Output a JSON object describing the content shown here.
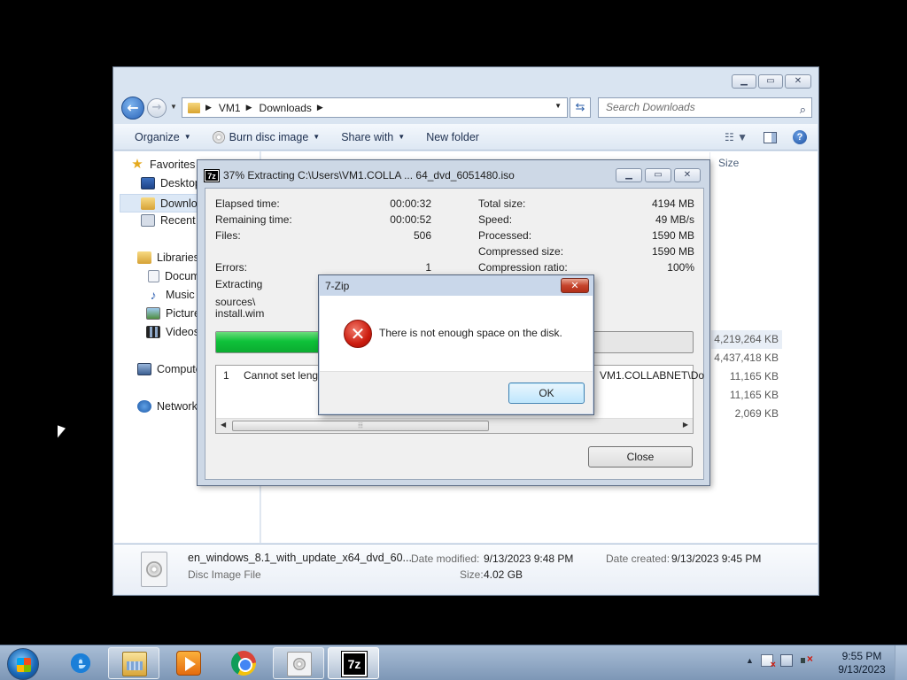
{
  "explorer": {
    "address": {
      "crumbs": [
        "VM1",
        "Downloads"
      ]
    },
    "search": {
      "placeholder": "Search Downloads"
    },
    "toolbar": {
      "organize": "Organize",
      "burn": "Burn disc image",
      "share": "Share with",
      "new_folder": "New folder"
    },
    "nav": {
      "favorites": "Favorites",
      "desktop": "Desktop",
      "downloads": "Downloads",
      "recent": "Recent Places",
      "libraries": "Libraries",
      "documents": "Documents",
      "music": "Music",
      "pictures": "Pictures",
      "videos": "Videos",
      "computer": "Computer",
      "network": "Network"
    },
    "columns": {
      "size": "Size"
    },
    "sizes": [
      "4,219,264 KB",
      "4,437,418 KB",
      "11,165 KB",
      "11,165 KB",
      "2,069 KB"
    ],
    "details": {
      "name": "en_windows_8.1_with_update_x64_dvd_60...",
      "type": "Disc Image File",
      "modified_label": "Date modified:",
      "modified_value": "9/13/2023 9:48 PM",
      "created_label": "Date created:",
      "created_value": "9/13/2023 9:45 PM",
      "size_label": "Size:",
      "size_value": "4.02 GB"
    }
  },
  "zip_dialog": {
    "title": "37% Extracting C:\\Users\\VM1.COLLA ... 64_dvd_6051480.iso",
    "logo": "7z",
    "progress_fraction": 0.37,
    "left_stats": [
      {
        "label": "Elapsed time:",
        "value": "00:00:32"
      },
      {
        "label": "Remaining time:",
        "value": "00:00:52"
      },
      {
        "label": "Files:",
        "value": "506"
      },
      {
        "label": "Errors:",
        "value": "1"
      }
    ],
    "right_stats": [
      {
        "label": "Total size:",
        "value": "4194 MB"
      },
      {
        "label": "Speed:",
        "value": "49 MB/s"
      },
      {
        "label": "Processed:",
        "value": "1590 MB"
      },
      {
        "label": "Compressed size:",
        "value": "1590 MB"
      },
      {
        "label": "Compression ratio:",
        "value": "100%"
      }
    ],
    "extracting_label": "Extracting",
    "current_path_1": "sources\\",
    "current_path_2": "install.wim",
    "error_row": {
      "num": "1",
      "text": "Cannot set length",
      "path_tail": "VM1.COLLABNET\\Do"
    },
    "close_label": "Close"
  },
  "message_box": {
    "title": "7-Zip",
    "text": "There is not enough space on the disk.",
    "ok_label": "OK"
  },
  "taskbar": {
    "items": [
      "start",
      "internet-explorer",
      "windows-explorer",
      "media-player",
      "chrome",
      "disc-image",
      "7-zip"
    ],
    "clock_time": "9:55 PM",
    "clock_date": "9/13/2023"
  }
}
